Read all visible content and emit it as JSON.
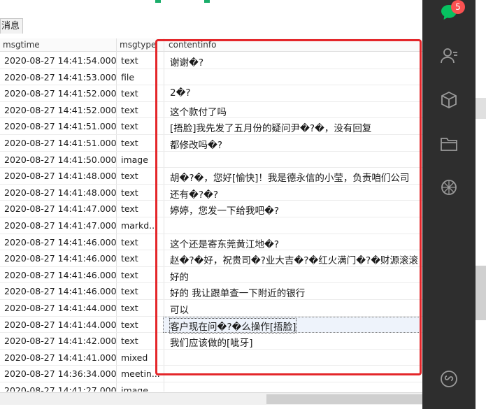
{
  "tab": {
    "label": "消息"
  },
  "columns": {
    "msgtime": "msgtime",
    "msgtype": "msgtype",
    "contentinfo": "contentinfo"
  },
  "rows": [
    {
      "time": "2020-08-27 14:41:54.000",
      "type": "text",
      "content": "谢谢�?"
    },
    {
      "time": "2020-08-27 14:41:53.000",
      "type": "file",
      "content": ""
    },
    {
      "time": "2020-08-27 14:41:52.000",
      "type": "text",
      "content": "2�?"
    },
    {
      "time": "2020-08-27 14:41:52.000",
      "type": "text",
      "content": "这个款付了吗"
    },
    {
      "time": "2020-08-27 14:41:51.000",
      "type": "text",
      "content": "[捂脸]我先发了五月份的疑问尹�?�，没有回复"
    },
    {
      "time": "2020-08-27 14:41:51.000",
      "type": "text",
      "content": "都修改吗�?"
    },
    {
      "time": "2020-08-27 14:41:50.000",
      "type": "image",
      "content": ""
    },
    {
      "time": "2020-08-27 14:41:48.000",
      "type": "text",
      "content": "胡�?�，您好[愉快]！我是德永信的小莹，负责咱们公司"
    },
    {
      "time": "2020-08-27 14:41:48.000",
      "type": "text",
      "content": "还有�?�?"
    },
    {
      "time": "2020-08-27 14:41:47.000",
      "type": "text",
      "content": "婷婷，您发一下给我吧�?"
    },
    {
      "time": "2020-08-27 14:41:47.000",
      "type": "markd...",
      "content": ""
    },
    {
      "time": "2020-08-27 14:41:46.000",
      "type": "text",
      "content": "这个还是寄东莞黄江地�?"
    },
    {
      "time": "2020-08-27 14:41:46.000",
      "type": "text",
      "content": "赵�?�好，祝贵司�?业大吉�?�红火满门�?�财源滚滚！"
    },
    {
      "time": "2020-08-27 14:41:46.000",
      "type": "text",
      "content": "好的"
    },
    {
      "time": "2020-08-27 14:41:46.000",
      "type": "text",
      "content": "好的 我让跟单查一下附近的银行"
    },
    {
      "time": "2020-08-27 14:41:44.000",
      "type": "text",
      "content": "可以"
    },
    {
      "time": "2020-08-27 14:41:44.000",
      "type": "text",
      "content": "客户现在问�?�么操作[捂脸]",
      "selected": true
    },
    {
      "time": "2020-08-27 14:41:42.000",
      "type": "text",
      "content": "我们应该做的[呲牙]"
    },
    {
      "time": "2020-08-27 14:41:41.000",
      "type": "mixed",
      "content": ""
    },
    {
      "time": "2020-08-27 14:36:34.000",
      "type": "meetin...",
      "content": ""
    },
    {
      "time": "2020-08-27 14:41:27.000",
      "type": "image",
      "content": ""
    }
  ],
  "sidebar": {
    "chat_badge": "5"
  },
  "colors": {
    "accent": "#1aad6a",
    "highlight": "#e4262a",
    "sidebar_bg": "#2e2e2e",
    "badge": "#fa5151"
  }
}
